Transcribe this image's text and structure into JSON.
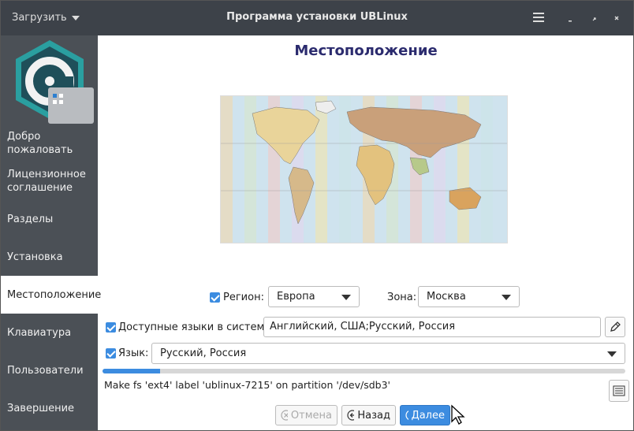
{
  "titlebar": {
    "menu_label": "Загрузить",
    "title": "Программа установки UBLinux",
    "icons": [
      "hamburger-icon",
      "minimize-icon",
      "maximize-icon",
      "close-icon"
    ]
  },
  "sidebar": {
    "items": [
      {
        "label": "Добро пожаловать"
      },
      {
        "label": "Лицензионное соглашение"
      },
      {
        "label": "Разделы"
      },
      {
        "label": "Установка"
      },
      {
        "label": "Местоположение",
        "active": true
      },
      {
        "label": "Клавиатура"
      },
      {
        "label": "Пользователи"
      },
      {
        "label": "Завершение"
      }
    ]
  },
  "main": {
    "title": "Местоположение",
    "region_label": "Регион:",
    "region_value": "Европа",
    "zone_label": "Зона:",
    "zone_value": "Москва",
    "languages_label": "Доступные языки в системе:",
    "languages_value": "Английский, США;Русский, Россия",
    "language_label": "Язык:",
    "language_value": "Русский, Россия"
  },
  "status": {
    "progress": 0.11,
    "log": "Make fs 'ext4' label 'ublinux-7215' on partition '/dev/sdb3'"
  },
  "buttons": {
    "cancel": "Отмена",
    "back": "Назад",
    "next": "Далее"
  },
  "colors": {
    "accent": "#3c8ce0",
    "titlebar": "#3d4249",
    "sidebar": "#4b5056",
    "title_text": "#2b2b6e"
  }
}
